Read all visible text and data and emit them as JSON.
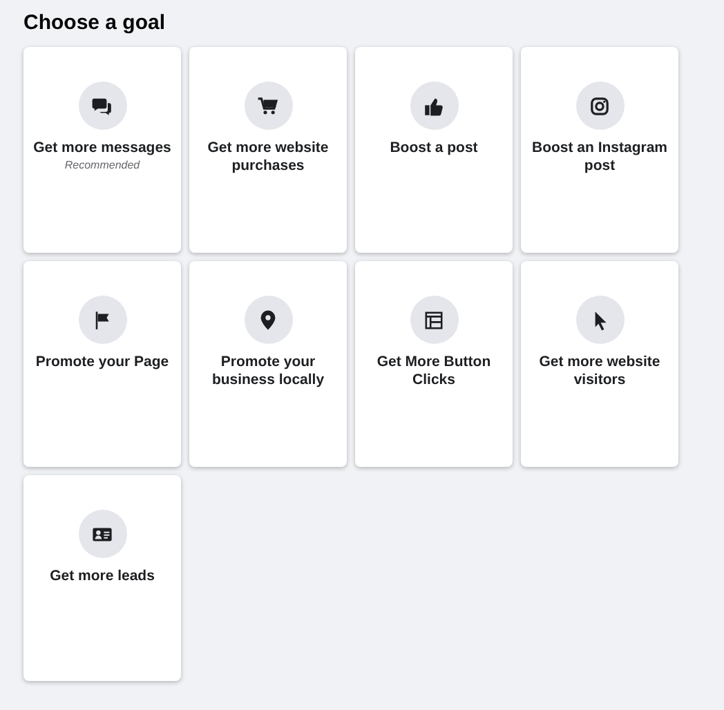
{
  "title": "Choose a goal",
  "goals": [
    {
      "kind": "chat",
      "label": "Get more messages",
      "note": "Recommended"
    },
    {
      "kind": "cart",
      "label": "Get more website purchases"
    },
    {
      "kind": "thumb",
      "label": "Boost a post"
    },
    {
      "kind": "camera",
      "label": "Boost an Instagram post"
    },
    {
      "kind": "flag",
      "label": "Promote your Page"
    },
    {
      "kind": "pin",
      "label": "Promote your business locally"
    },
    {
      "kind": "layout",
      "label": "Get More Button Clicks"
    },
    {
      "kind": "cursor",
      "label": "Get more website visitors"
    },
    {
      "kind": "card",
      "label": "Get more leads"
    }
  ]
}
